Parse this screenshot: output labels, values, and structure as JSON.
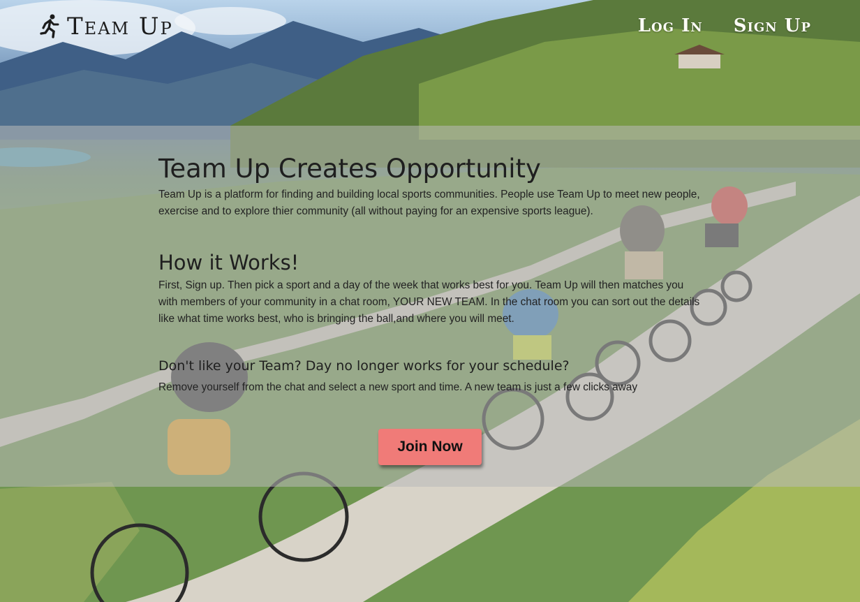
{
  "header": {
    "brand": "Team Up",
    "nav": {
      "login": "Log In",
      "signup": "Sign Up"
    }
  },
  "intro": {
    "title": "Team Up Creates Opportunity",
    "body": "Team Up is a platform for finding and building local sports communities. People use Team Up to meet new people, exercise and to explore thier community (all without paying for an expensive sports league)."
  },
  "how": {
    "title": "How it Works!",
    "body": "First, Sign up. Then pick a sport and a day of the week that works best for you. Team Up will then matches you with members of your community in a chat room, YOUR NEW TEAM. In the chat room you can sort out the details like what time works best, who is bringing the ball,and where you will meet."
  },
  "change": {
    "title": "Don't like your Team? Day no longer works for your schedule?",
    "body": "Remove yourself from the chat and select a new sport and time. A new team is just a few clicks away"
  },
  "cta": {
    "label": "Join Now",
    "color": "#f07b78"
  },
  "icons": {
    "logo": "running-person-icon"
  }
}
